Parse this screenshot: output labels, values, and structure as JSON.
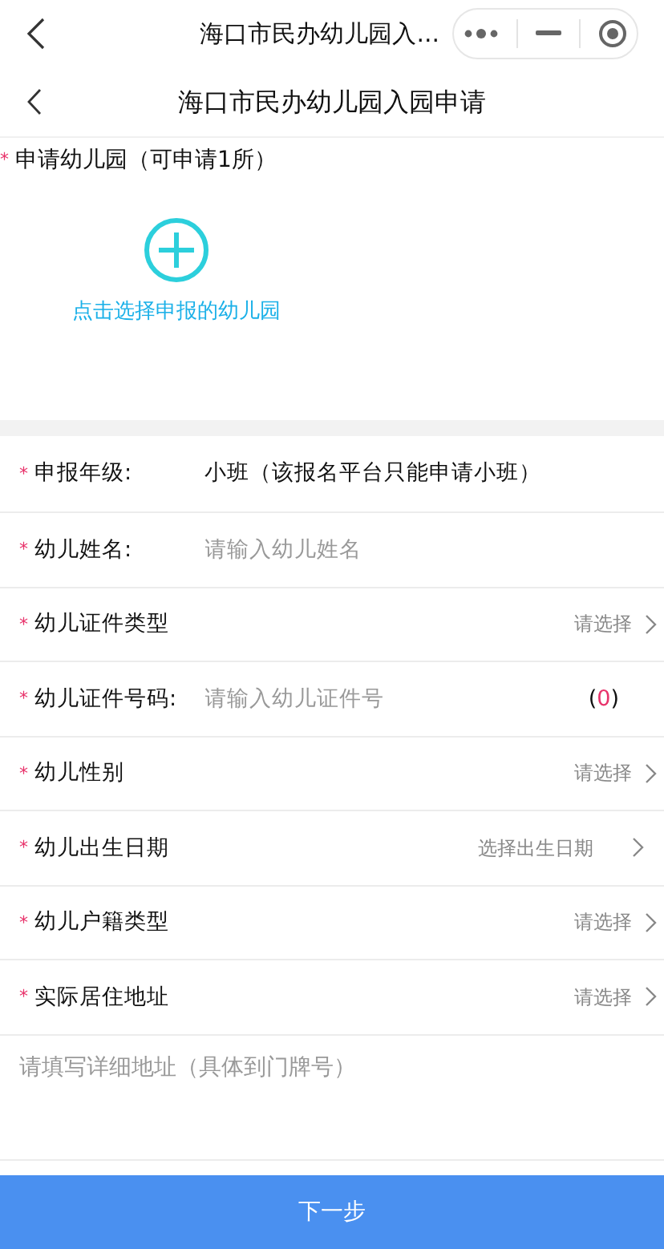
{
  "mini_bar": {
    "title": "海口市民办幼儿园入..."
  },
  "header": {
    "title": "海口市民办幼儿园入园申请"
  },
  "kindergarten": {
    "required_mark": "*",
    "label": "申请幼儿园（可申请1所）",
    "add_label": "点击选择申报的幼儿园"
  },
  "fields": [
    {
      "kind": "static",
      "required_mark": "*",
      "label": "申报年级:",
      "value": "小班（该报名平台只能申请小班）"
    },
    {
      "kind": "input",
      "required_mark": "*",
      "label": "幼儿姓名:",
      "placeholder": "请输入幼儿姓名"
    },
    {
      "kind": "select",
      "required_mark": "*",
      "label": "幼儿证件类型",
      "placeholder": "请选择"
    },
    {
      "kind": "counter",
      "required_mark": "*",
      "label": "幼儿证件号码:",
      "placeholder": "请输入幼儿证件号",
      "counter_open": "(",
      "counter": "0",
      "counter_close": ")"
    },
    {
      "kind": "select",
      "required_mark": "*",
      "label": "幼儿性别",
      "placeholder": "请选择"
    },
    {
      "kind": "date",
      "required_mark": "*",
      "label": "幼儿出生日期",
      "placeholder": "选择出生日期"
    },
    {
      "kind": "select",
      "required_mark": "*",
      "label": "幼儿户籍类型",
      "placeholder": "请选择"
    },
    {
      "kind": "select",
      "required_mark": "*",
      "label": "实际居住地址",
      "placeholder": "请选择"
    }
  ],
  "address": {
    "placeholder": "请填写详细地址（具体到门牌号）"
  },
  "next_button": {
    "label": "下一步"
  }
}
